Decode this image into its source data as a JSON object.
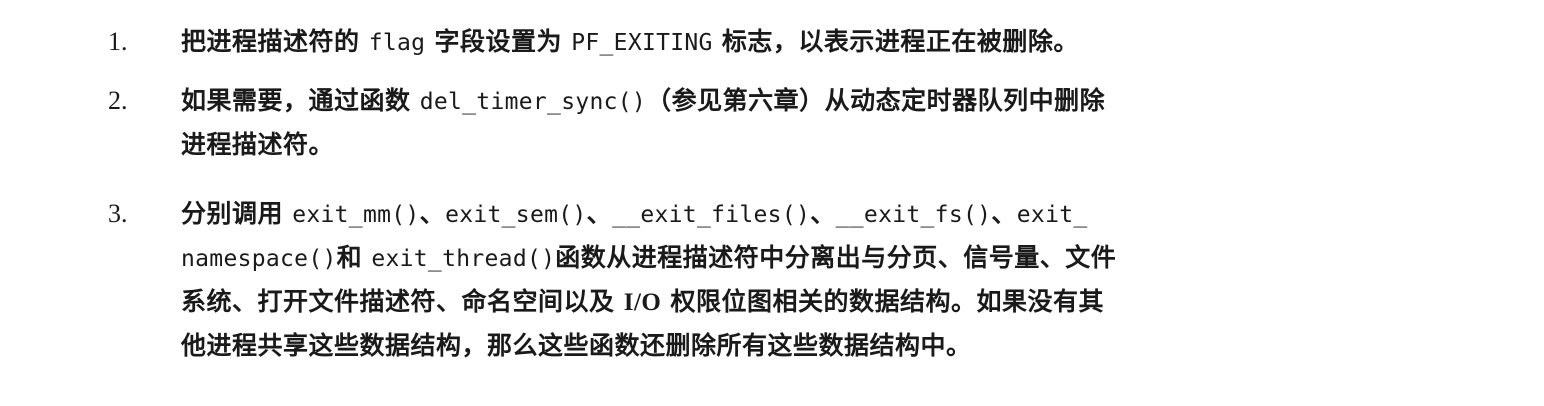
{
  "items": [
    {
      "number": "1.",
      "lines": [
        [
          {
            "t": "把进程描述符的 ",
            "s": "cn"
          },
          {
            "t": "flag",
            "s": "mono"
          },
          {
            "t": " 字段设置为 ",
            "s": "cn"
          },
          {
            "t": "PF_EXITING",
            "s": "mono"
          },
          {
            "t": " 标志，以表示进程正在被删除。",
            "s": "cn"
          }
        ]
      ]
    },
    {
      "number": "2.",
      "lines": [
        [
          {
            "t": "如果需要，通过函数 ",
            "s": "cn"
          },
          {
            "t": "del_timer_sync()",
            "s": "mono"
          },
          {
            "t": "（参见第六章）从动态定时器队列中删除",
            "s": "cn"
          }
        ],
        [
          {
            "t": "进程描述符。",
            "s": "cn"
          }
        ]
      ]
    },
    {
      "number": "3.",
      "lines": [
        [
          {
            "t": "分别调用 ",
            "s": "cn"
          },
          {
            "t": "exit_mm()",
            "s": "mono"
          },
          {
            "t": "、",
            "s": "cn"
          },
          {
            "t": "exit_sem()",
            "s": "mono"
          },
          {
            "t": "、",
            "s": "cn"
          },
          {
            "t": "__exit_files()",
            "s": "mono"
          },
          {
            "t": "、",
            "s": "cn"
          },
          {
            "t": "__exit_fs()",
            "s": "mono"
          },
          {
            "t": "、",
            "s": "cn"
          },
          {
            "t": "exit_",
            "s": "mono"
          }
        ],
        [
          {
            "t": "namespace()",
            "s": "mono"
          },
          {
            "t": "和 ",
            "s": "cn"
          },
          {
            "t": "exit_thread()",
            "s": "mono"
          },
          {
            "t": "函数从进程描述符中分离出与分页、信号量、文件",
            "s": "cn"
          }
        ],
        [
          {
            "t": "系统、打开文件描述符、命名空间以及 ",
            "s": "cn"
          },
          {
            "t": "I/O",
            "s": "roman"
          },
          {
            "t": " 权限位图相关的数据结构。如果没有其",
            "s": "cn"
          }
        ],
        [
          {
            "t": "他进程共享这些数据结构，那么这些函数还删除所有这些数据结构中。",
            "s": "cn"
          }
        ]
      ]
    }
  ]
}
